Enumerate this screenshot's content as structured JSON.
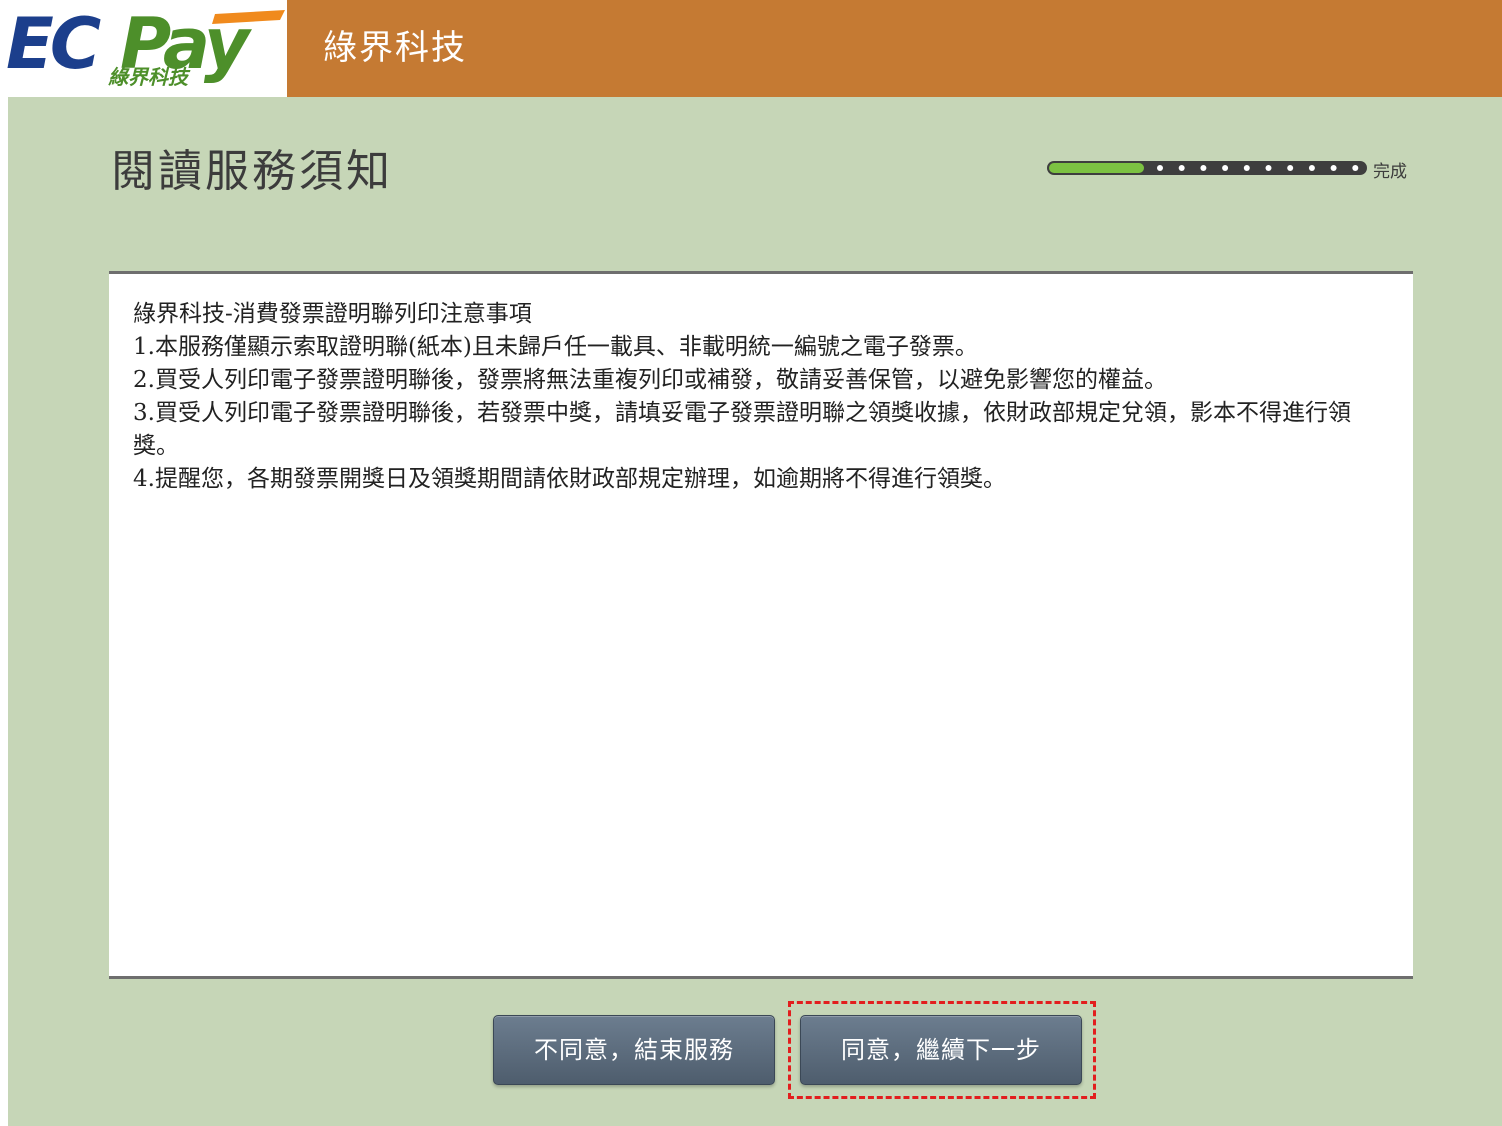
{
  "header": {
    "logo_wordmark": "ECPay",
    "logo_subtext": "綠界科技",
    "title": "綠界科技"
  },
  "page": {
    "title": "閱讀服務須知"
  },
  "progress": {
    "label": "完成",
    "fraction_complete": 0.3
  },
  "notice": {
    "heading": "綠界科技-消費發票證明聯列印注意事項",
    "items": [
      "1.本服務僅顯示索取證明聯(紙本)且未歸戶任一載具、非載明統一編號之電子發票。",
      "2.買受人列印電子發票證明聯後，發票將無法重複列印或補發，敬請妥善保管，以避免影響您的權益。",
      "3.買受人列印電子發票證明聯後，若發票中獎，請填妥電子發票證明聯之領獎收據，依財政部規定兌領，影本不得進行領獎。",
      "4.提醒您，各期發票開獎日及領獎期間請依財政部規定辦理，如逾期將不得進行領獎。"
    ]
  },
  "buttons": {
    "disagree_label": "不同意，結束服務",
    "agree_label": "同意，繼續下一步"
  },
  "colors": {
    "header_band": "#c57a33",
    "panel_bg": "#c6d6b7",
    "progress_fill": "#7cc242",
    "button_bg": "#5a6a7b",
    "highlight": "#e21e1e"
  }
}
